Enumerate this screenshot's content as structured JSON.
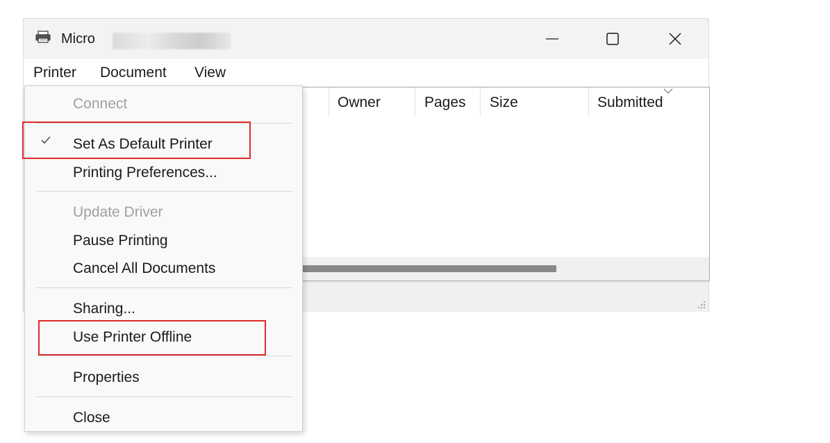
{
  "window": {
    "title": "Micro",
    "controls": {
      "minimize_icon": "minimize-icon",
      "maximize_icon": "maximize-icon",
      "close_icon": "close-icon"
    }
  },
  "menubar": {
    "items": [
      "Printer",
      "Document",
      "View"
    ]
  },
  "columns": {
    "owner": "Owner",
    "pages": "Pages",
    "size": "Size",
    "submitted": "Submitted"
  },
  "printer_menu": {
    "items": [
      {
        "label": "Connect",
        "enabled": false
      },
      {
        "label": "Set As Default Printer",
        "checked": true,
        "highlighted": true
      },
      {
        "label": "Printing Preferences..."
      },
      {
        "label": "Update Driver",
        "enabled": false
      },
      {
        "label": "Pause Printing"
      },
      {
        "label": "Cancel All Documents"
      },
      {
        "label": "Sharing..."
      },
      {
        "label": "Use Printer Offline",
        "highlighted": true
      },
      {
        "label": "Properties"
      },
      {
        "label": "Close"
      }
    ]
  },
  "colors": {
    "highlight_border": "#e02a2a",
    "disabled_text": "#a0a0a0",
    "scroll_thumb": "#898989"
  }
}
